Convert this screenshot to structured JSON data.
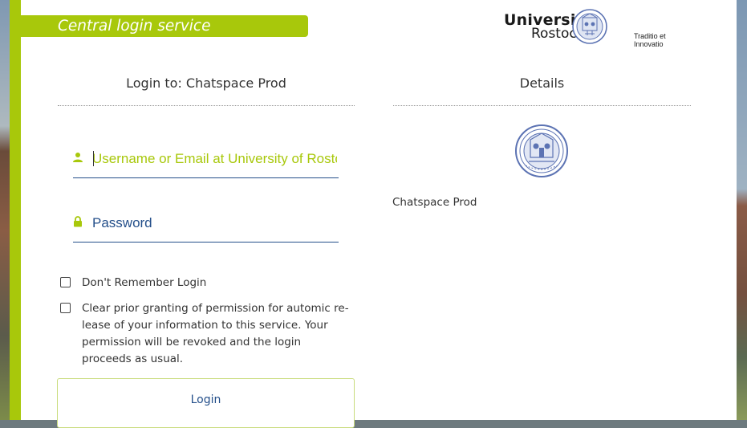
{
  "header": {
    "service_title": "Central login service"
  },
  "logo": {
    "line1": "Universität",
    "line2": "Rostock",
    "motto": "Traditio et Innovatio",
    "seal_icon": "university-seal-icon"
  },
  "login": {
    "heading": "Login to: Chatspace Prod",
    "username_placeholder": "Username or Email at University of Rosto...",
    "password_placeholder": "Password",
    "dont_remember_label": "Don't Remember Login",
    "clear_permission_label": "Clear prior granting of permission for automic re­lease of your information to this service. Your per­mission will be revoked and the login proceeds as usual.",
    "login_button": "Login"
  },
  "details": {
    "heading": "Details",
    "service_name": "Chatspace Prod"
  },
  "colors": {
    "accent": "#a8c80b",
    "blue": "#244f8a",
    "seal": "#5c73b3"
  }
}
